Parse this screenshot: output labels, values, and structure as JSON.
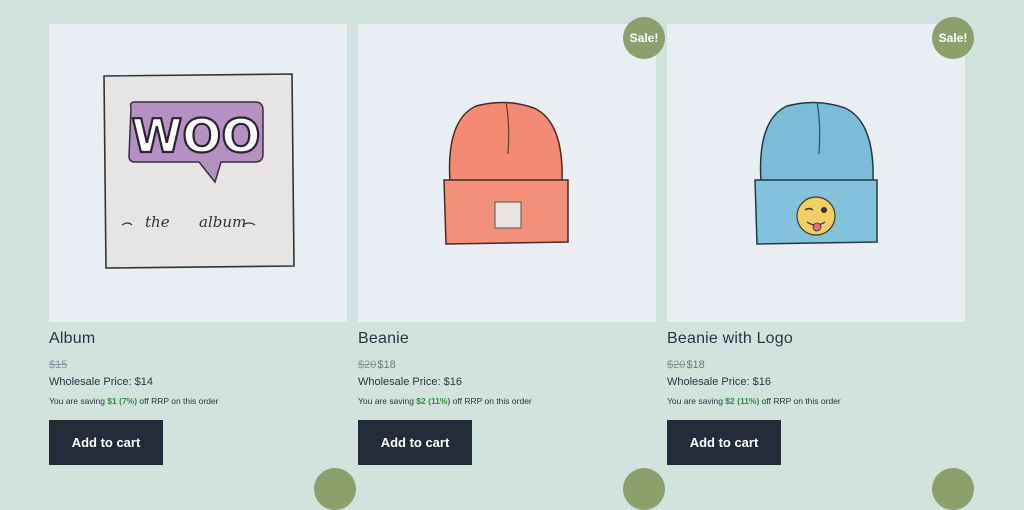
{
  "products": [
    {
      "title": "Album",
      "sale_badge": "",
      "price_old": "$15",
      "price_new": "",
      "wholesale": "Wholesale Price: $14",
      "saving_prefix": "You are saving ",
      "saving_amount": "$1 (7%)",
      "saving_suffix": " off RRP on this order",
      "button": "Add to cart",
      "image_art": "woo-album"
    },
    {
      "title": "Beanie",
      "sale_badge": "Sale!",
      "price_old": "$20",
      "price_new": "$18",
      "wholesale": "Wholesale Price: $16",
      "saving_prefix": "You are saving ",
      "saving_amount": "$2 (11%)",
      "saving_suffix": " off RRP on this order",
      "button": "Add to cart",
      "image_art": "orange-beanie"
    },
    {
      "title": "Beanie with Logo",
      "sale_badge": "Sale!",
      "price_old": "$20",
      "price_new": "$18",
      "wholesale": "Wholesale Price: $16",
      "saving_prefix": "You are saving ",
      "saving_amount": "$2 (11%)",
      "saving_suffix": " off RRP on this order",
      "button": "Add to cart",
      "image_art": "blue-beanie-logo"
    }
  ],
  "art": {
    "woo_text": "WOO",
    "album_the": "the",
    "album_word": "album"
  },
  "colors": {
    "page_bg": "#d2e3de",
    "card_bg": "#e8eef1",
    "sale_badge": "#8c9f6c",
    "button_bg": "#232b38",
    "saving_green": "#2e8b3a"
  }
}
